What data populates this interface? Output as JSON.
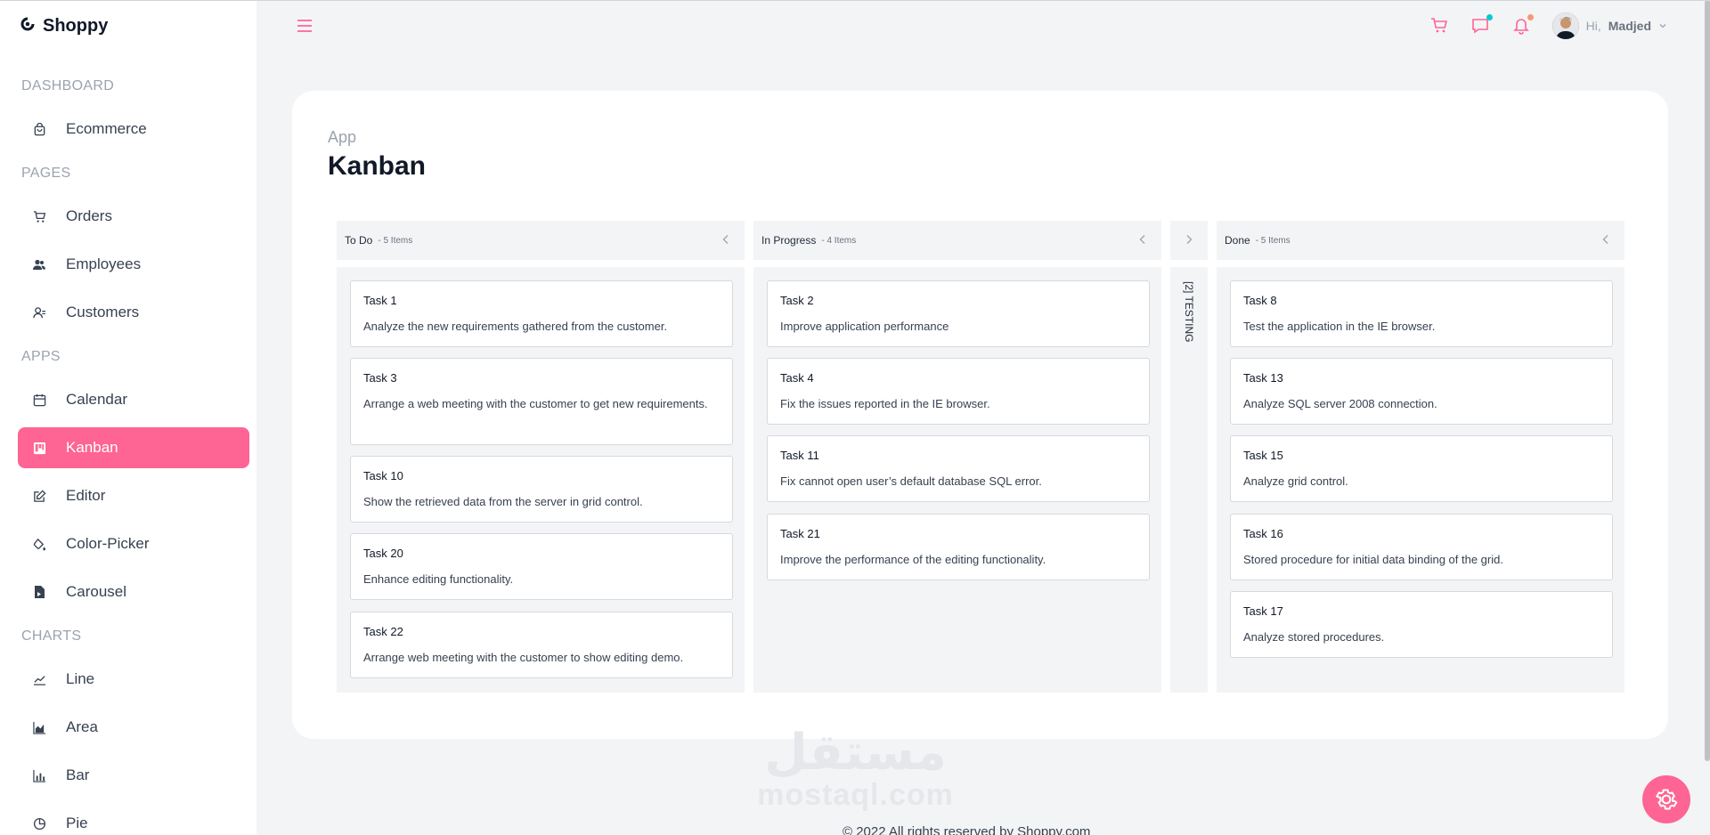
{
  "brand": {
    "name": "Shoppy"
  },
  "sidebar": {
    "sections": [
      {
        "title": "DASHBOARD",
        "items": [
          {
            "label": "Ecommerce",
            "icon": "shopping-bag-icon"
          }
        ]
      },
      {
        "title": "PAGES",
        "items": [
          {
            "label": "Orders",
            "icon": "cart-icon"
          },
          {
            "label": "Employees",
            "icon": "people-icon"
          },
          {
            "label": "Customers",
            "icon": "user-icon"
          }
        ]
      },
      {
        "title": "APPS",
        "items": [
          {
            "label": "Calendar",
            "icon": "calendar-icon"
          },
          {
            "label": "Kanban",
            "icon": "kanban-icon",
            "active": true
          },
          {
            "label": "Editor",
            "icon": "edit-icon"
          },
          {
            "label": "Color-Picker",
            "icon": "paint-bucket-icon"
          },
          {
            "label": "Carousel",
            "icon": "carousel-icon"
          }
        ]
      },
      {
        "title": "CHARTS",
        "items": [
          {
            "label": "Line",
            "icon": "line-chart-icon"
          },
          {
            "label": "Area",
            "icon": "area-chart-icon"
          },
          {
            "label": "Bar",
            "icon": "bar-chart-icon"
          },
          {
            "label": "Pie",
            "icon": "pie-chart-icon"
          }
        ]
      }
    ]
  },
  "topbar": {
    "greeting": "Hi,",
    "user_name": "Madjed"
  },
  "page": {
    "breadcrumb": "App",
    "title": "Kanban"
  },
  "kanban": {
    "columns": [
      {
        "title": "To Do",
        "count": "- 5 Items",
        "tasks": [
          {
            "name": "Task 1",
            "desc": "Analyze the new requirements gathered from the customer."
          },
          {
            "name": "Task 3",
            "desc": "Arrange a web meeting with the customer to get new requirements."
          },
          {
            "name": "Task 10",
            "desc": "Show the retrieved data from the server in grid control."
          },
          {
            "name": "Task 20",
            "desc": "Enhance editing functionality."
          },
          {
            "name": "Task 22",
            "desc": "Arrange web meeting with the customer to show editing demo."
          }
        ]
      },
      {
        "title": "In Progress",
        "count": "- 4 Items",
        "tasks": [
          {
            "name": "Task 2",
            "desc": "Improve application performance"
          },
          {
            "name": "Task 4",
            "desc": "Fix the issues reported in the IE browser."
          },
          {
            "name": "Task 11",
            "desc": "Fix cannot open user’s default database SQL error."
          },
          {
            "name": "Task 21",
            "desc": "Improve the performance of the editing functionality."
          }
        ]
      },
      {
        "title": "Done",
        "count": "- 5 Items",
        "tasks": [
          {
            "name": "Task 8",
            "desc": "Test the application in the IE browser."
          },
          {
            "name": "Task 13",
            "desc": "Analyze SQL server 2008 connection."
          },
          {
            "name": "Task 15",
            "desc": "Analyze grid control."
          },
          {
            "name": "Task 16",
            "desc": "Stored procedure for initial data binding of the grid."
          },
          {
            "name": "Task 17",
            "desc": "Analyze stored procedures."
          }
        ]
      }
    ],
    "collapsed_column": {
      "label": "[2] TESTING"
    }
  },
  "watermark": {
    "arabic": "مستقل",
    "latin": "mostaql.com"
  },
  "footer": {
    "text": "© 2022 All rights reserved by Shoppy.com"
  },
  "colors": {
    "accent": "#fe6494",
    "chat_dot": "#03c9d7",
    "bell_dot": "#fb9678"
  }
}
